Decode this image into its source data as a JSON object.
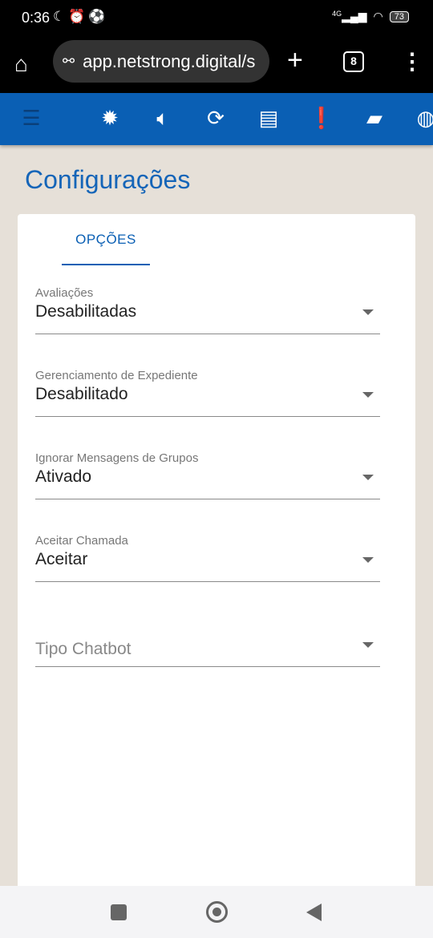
{
  "status": {
    "time": "0:36",
    "network": "4G",
    "battery": "73"
  },
  "browser": {
    "url": "app.netstrong.digital/s",
    "tab_count": "8"
  },
  "toolbar": {
    "icons": [
      "menu-icon",
      "brightness-icon",
      "volume-icon",
      "sync-icon",
      "message-icon",
      "alert-message-icon",
      "forum-icon",
      "globe-icon"
    ]
  },
  "page": {
    "title": "Configurações",
    "tab": "OPÇÕES"
  },
  "fields": [
    {
      "label": "Avaliações",
      "value": "Desabilitadas"
    },
    {
      "label": "Gerenciamento de Expediente",
      "value": "Desabilitado"
    },
    {
      "label": "Ignorar Mensagens de Grupos",
      "value": "Ativado"
    },
    {
      "label": "Aceitar Chamada",
      "value": "Aceitar"
    },
    {
      "placeholder": "Tipo Chatbot"
    }
  ],
  "colors": {
    "primary": "#0a5fb4"
  }
}
